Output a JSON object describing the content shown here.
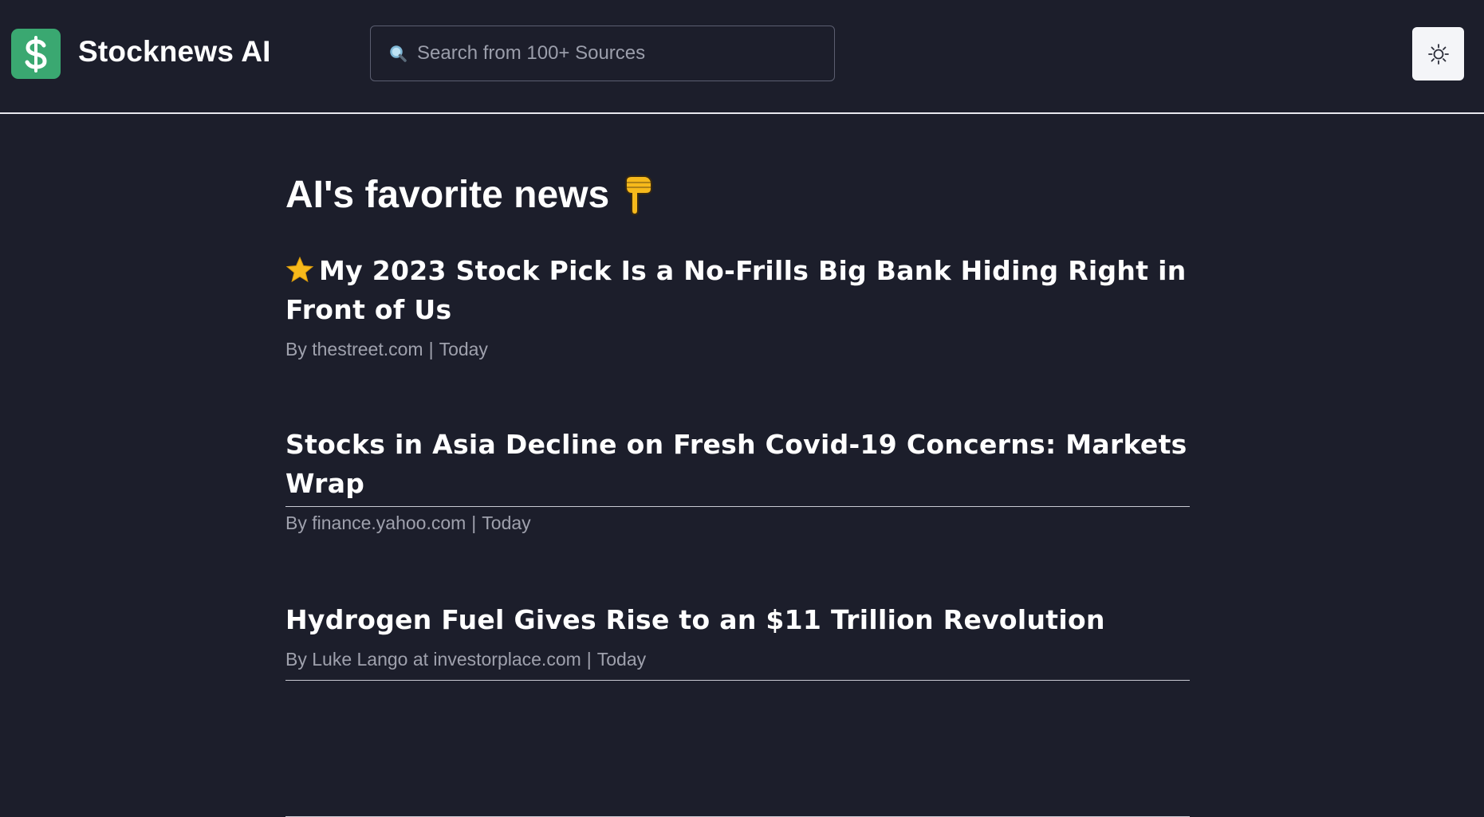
{
  "app": {
    "name": "Stocknews AI",
    "logo_icon": "dollar-sign-icon",
    "brand_color": "#3aa871"
  },
  "search": {
    "placeholder": "Search from 100+ Sources",
    "icon": "search-icon"
  },
  "theme_toggle": {
    "icon": "sun-icon"
  },
  "section": {
    "title": "AI's favorite news",
    "icon": "pointing-down-hand-icon"
  },
  "articles": [
    {
      "featured": true,
      "title": "My 2023 Stock Pick Is a No-Frills Big Bank Hiding Right in Front of Us",
      "byline": "By thestreet.com",
      "separator": "|",
      "date": "Today"
    },
    {
      "featured": false,
      "title": "Stocks in Asia Decline on Fresh Covid-19 Concerns: Markets Wrap",
      "byline": "By finance.yahoo.com",
      "separator": "|",
      "date": "Today"
    },
    {
      "featured": false,
      "title": "Hydrogen Fuel Gives Rise to an $11 Trillion Revolution",
      "byline": "By Luke Lango at investorplace.com",
      "separator": "|",
      "date": "Today"
    }
  ],
  "colors": {
    "background": "#1c1e2b",
    "text": "#ffffff",
    "meta_text": "#9fa1ad",
    "star": "#f6b91b"
  }
}
